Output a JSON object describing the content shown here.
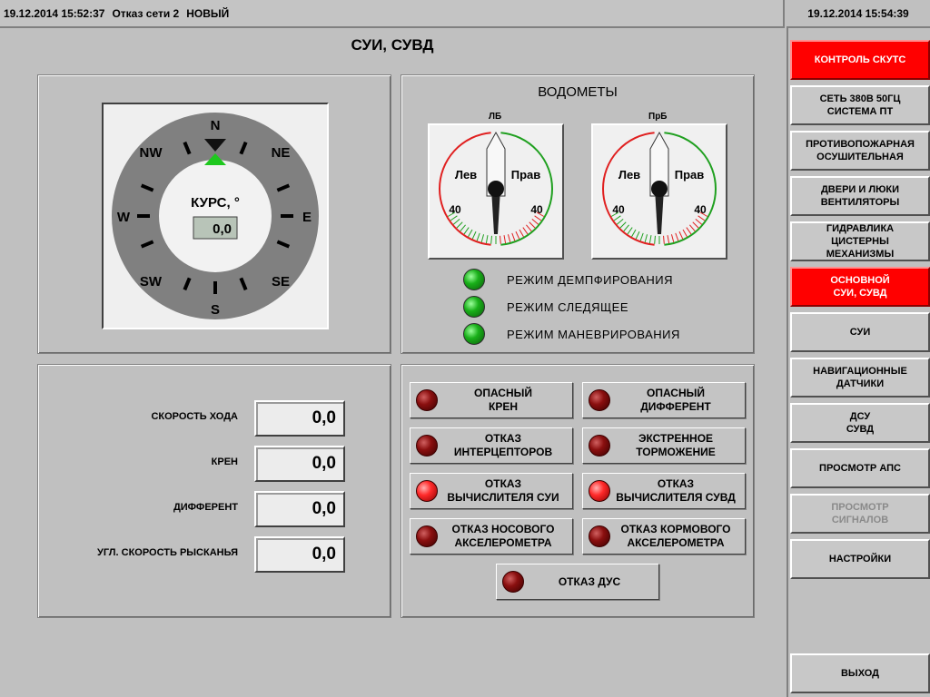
{
  "header": {
    "event_time": "19.12.2014 15:52:37",
    "event_text": "Отказ сети 2",
    "event_status": "НОВЫЙ",
    "clock": "19.12.2014 15:54:39"
  },
  "page_title": "СУИ, СУВД",
  "compass": {
    "label": "КУРС, °",
    "value": "0,0",
    "heading_deg": 0,
    "directions": {
      "n": "N",
      "ne": "NE",
      "e": "E",
      "se": "SE",
      "s": "S",
      "sw": "SW",
      "w": "W",
      "nw": "NW"
    }
  },
  "waterjets": {
    "title": "ВОДОМЕТЫ",
    "left": {
      "label": "ЛБ",
      "side_left": "Лев",
      "side_right": "Прав",
      "scale_left": "40",
      "scale_right": "40",
      "angle_deg": 0
    },
    "right": {
      "label": "ПрБ",
      "side_left": "Лев",
      "side_right": "Прав",
      "scale_left": "40",
      "scale_right": "40",
      "angle_deg": 0
    },
    "modes": [
      {
        "label": "РЕЖИМ ДЕМПФИРОВАНИЯ",
        "color": "#19b019"
      },
      {
        "label": "РЕЖИМ СЛЕДЯЩЕЕ",
        "color": "#19b019"
      },
      {
        "label": "РЕЖИМ МАНЕВРИРОВАНИЯ",
        "color": "#19b019"
      }
    ]
  },
  "readouts": [
    {
      "label": "СКОРОСТЬ ХОДА",
      "value": "0,0"
    },
    {
      "label": "КРЕН",
      "value": "0,0"
    },
    {
      "label": "ДИФФЕРЕНТ",
      "value": "0,0"
    },
    {
      "label": "УГЛ. СКОРОСТЬ РЫСКАНЬЯ",
      "value": "0,0"
    }
  ],
  "alarms": [
    {
      "line1": "ОПАСНЫЙ",
      "line2": "КРЕН",
      "state": "dark"
    },
    {
      "line1": "ОПАСНЫЙ",
      "line2": "ДИФФЕРЕНТ",
      "state": "dark"
    },
    {
      "line1": "ОТКАЗ",
      "line2": "ИНТЕРЦЕПТОРОВ",
      "state": "dark"
    },
    {
      "line1": "ЭКСТРЕННОЕ",
      "line2": "ТОРМОЖЕНИЕ",
      "state": "dark"
    },
    {
      "line1": "ОТКАЗ",
      "line2": "ВЫЧИСЛИТЕЛЯ СУИ",
      "state": "bright"
    },
    {
      "line1": "ОТКАЗ",
      "line2": "ВЫЧИСЛИТЕЛЯ СУВД",
      "state": "bright"
    },
    {
      "line1": "ОТКАЗ НОСОВОГО",
      "line2": "АКСЕЛЕРОМЕТРА",
      "state": "dark"
    },
    {
      "line1": "ОТКАЗ КОРМОВОГО",
      "line2": "АКСЕЛЕРОМЕТРА",
      "state": "dark"
    },
    {
      "line1": "ОТКАЗ ДУС",
      "line2": "",
      "state": "dark"
    }
  ],
  "nav": {
    "items": [
      {
        "line1": "КОНТРОЛЬ СКУТС",
        "line2": "",
        "line3": ""
      },
      {
        "line1": "СЕТЬ 380В 50ГЦ",
        "line2": "СИСТЕМА ПТ",
        "line3": ""
      },
      {
        "line1": "ПРОТИВОПОЖАРНАЯ",
        "line2": "ОСУШИТЕЛЬНАЯ",
        "line3": ""
      },
      {
        "line1": "ДВЕРИ И ЛЮКИ",
        "line2": "ВЕНТИЛЯТОРЫ",
        "line3": ""
      },
      {
        "line1": "ГИДРАВЛИКА",
        "line2": "ЦИСТЕРНЫ",
        "line3": "МЕХАНИЗМЫ"
      },
      {
        "line1": "ОСНОВНОЙ",
        "line2": "СУИ, СУВД",
        "line3": ""
      },
      {
        "line1": "СУИ",
        "line2": "",
        "line3": ""
      },
      {
        "line1": "НАВИГАЦИОННЫЕ",
        "line2": "ДАТЧИКИ",
        "line3": ""
      },
      {
        "line1": "ДСУ",
        "line2": "СУВД",
        "line3": ""
      },
      {
        "line1": "ПРОСМОТР АПС",
        "line2": "",
        "line3": ""
      },
      {
        "line1": "ПРОСМОТР",
        "line2": "СИГНАЛОВ",
        "line3": ""
      },
      {
        "line1": "НАСТРОЙКИ",
        "line2": "",
        "line3": ""
      }
    ],
    "exit": "ВЫХОД"
  },
  "colors": {
    "active_nav": "#ff0000",
    "alarm_dark": "#8a0f0f",
    "alarm_bright": "#ff2a2a",
    "mode_led": "#19b019",
    "arc_left": "#e02020",
    "arc_right": "#20a020"
  }
}
